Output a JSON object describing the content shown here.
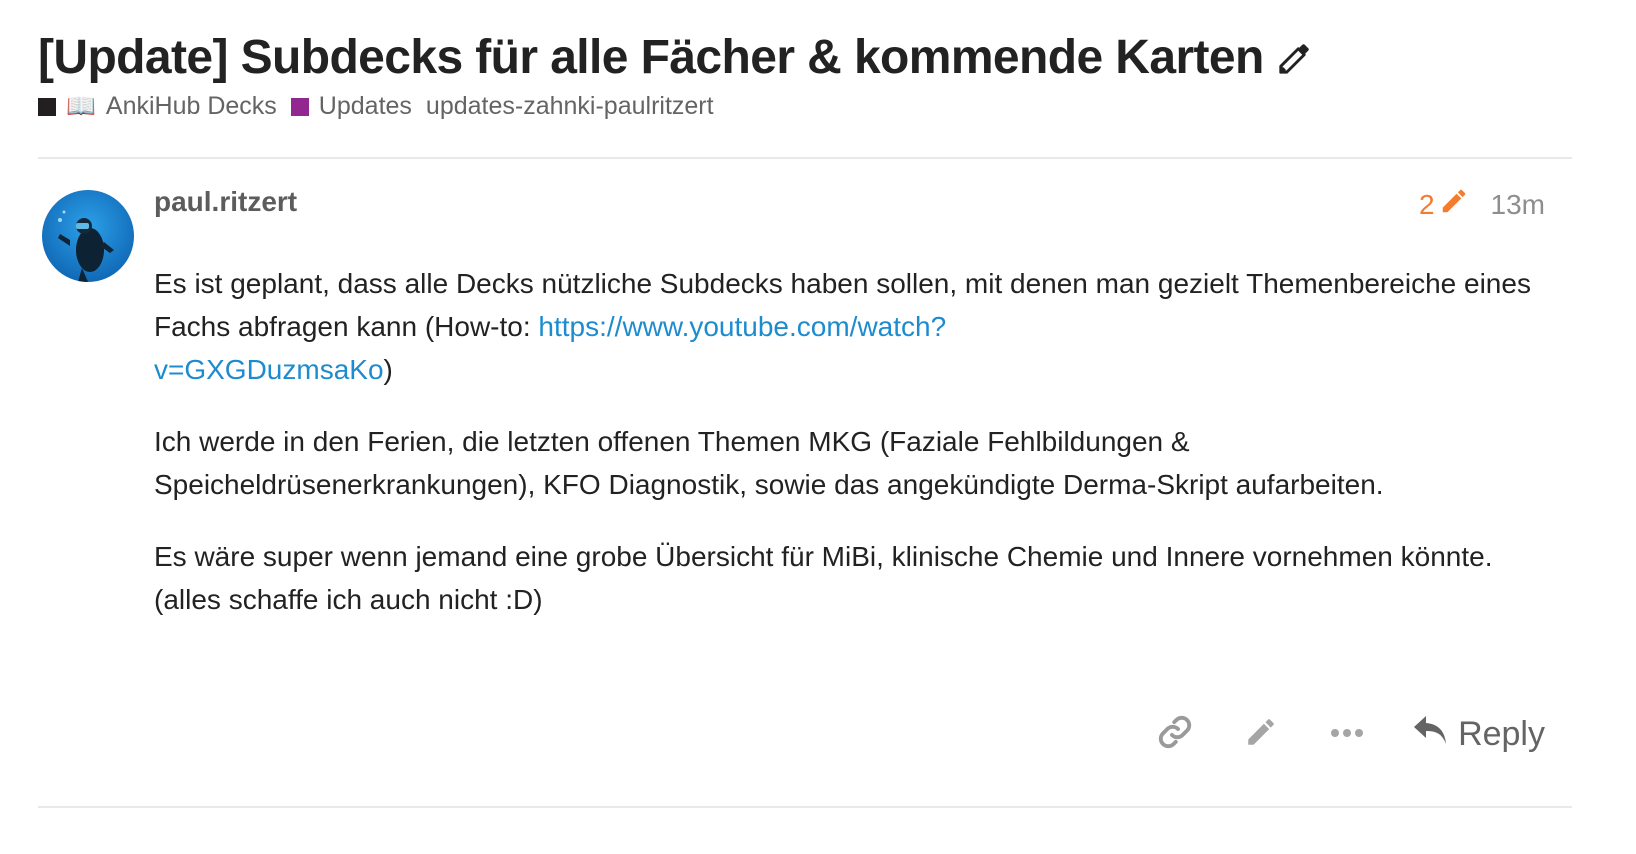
{
  "topic": {
    "title": "[Update] Subdecks für alle Fächer & kommende Karten",
    "edit_icon": "pencil-icon",
    "categories": [
      {
        "emoji": "📖",
        "label": "AnkiHub Decks",
        "color": "#231f20"
      },
      {
        "label": "Updates",
        "color": "#92278f"
      }
    ],
    "tag": "updates-zahnki-paulritzert"
  },
  "post": {
    "username": "paul.ritzert",
    "edit_count": "2",
    "edit_color": "#f27d2e",
    "time": "13m",
    "p1_text": "Es ist geplant, dass alle Decks nützliche Subdecks haben sollen, mit denen man gezielt Themenbereiche eines Fachs abfragen kann (How-to: ",
    "p1_link_line1": "https://www.youtube.com/watch?",
    "p1_link_line2": "v=GXGDuzmsaKo",
    "p1_after": ")",
    "p2": "Ich werde in den Ferien, die letzten offenen Themen MKG (Faziale Fehlbildungen & Speicheldrüsenerkrankungen), KFO Diagnostik, sowie das angekündigte Derma-Skript aufarbeiten.",
    "p3": "Es wäre super wenn jemand eine grobe Übersicht für MiBi, klinische Chemie und Innere vornehmen könnte. (alles schaffe ich auch nicht :D)"
  },
  "actions": {
    "link_icon": "link-icon",
    "edit_icon": "pencil-icon",
    "more_icon": "more-icon",
    "reply_icon": "reply-icon",
    "reply_label": "Reply"
  }
}
